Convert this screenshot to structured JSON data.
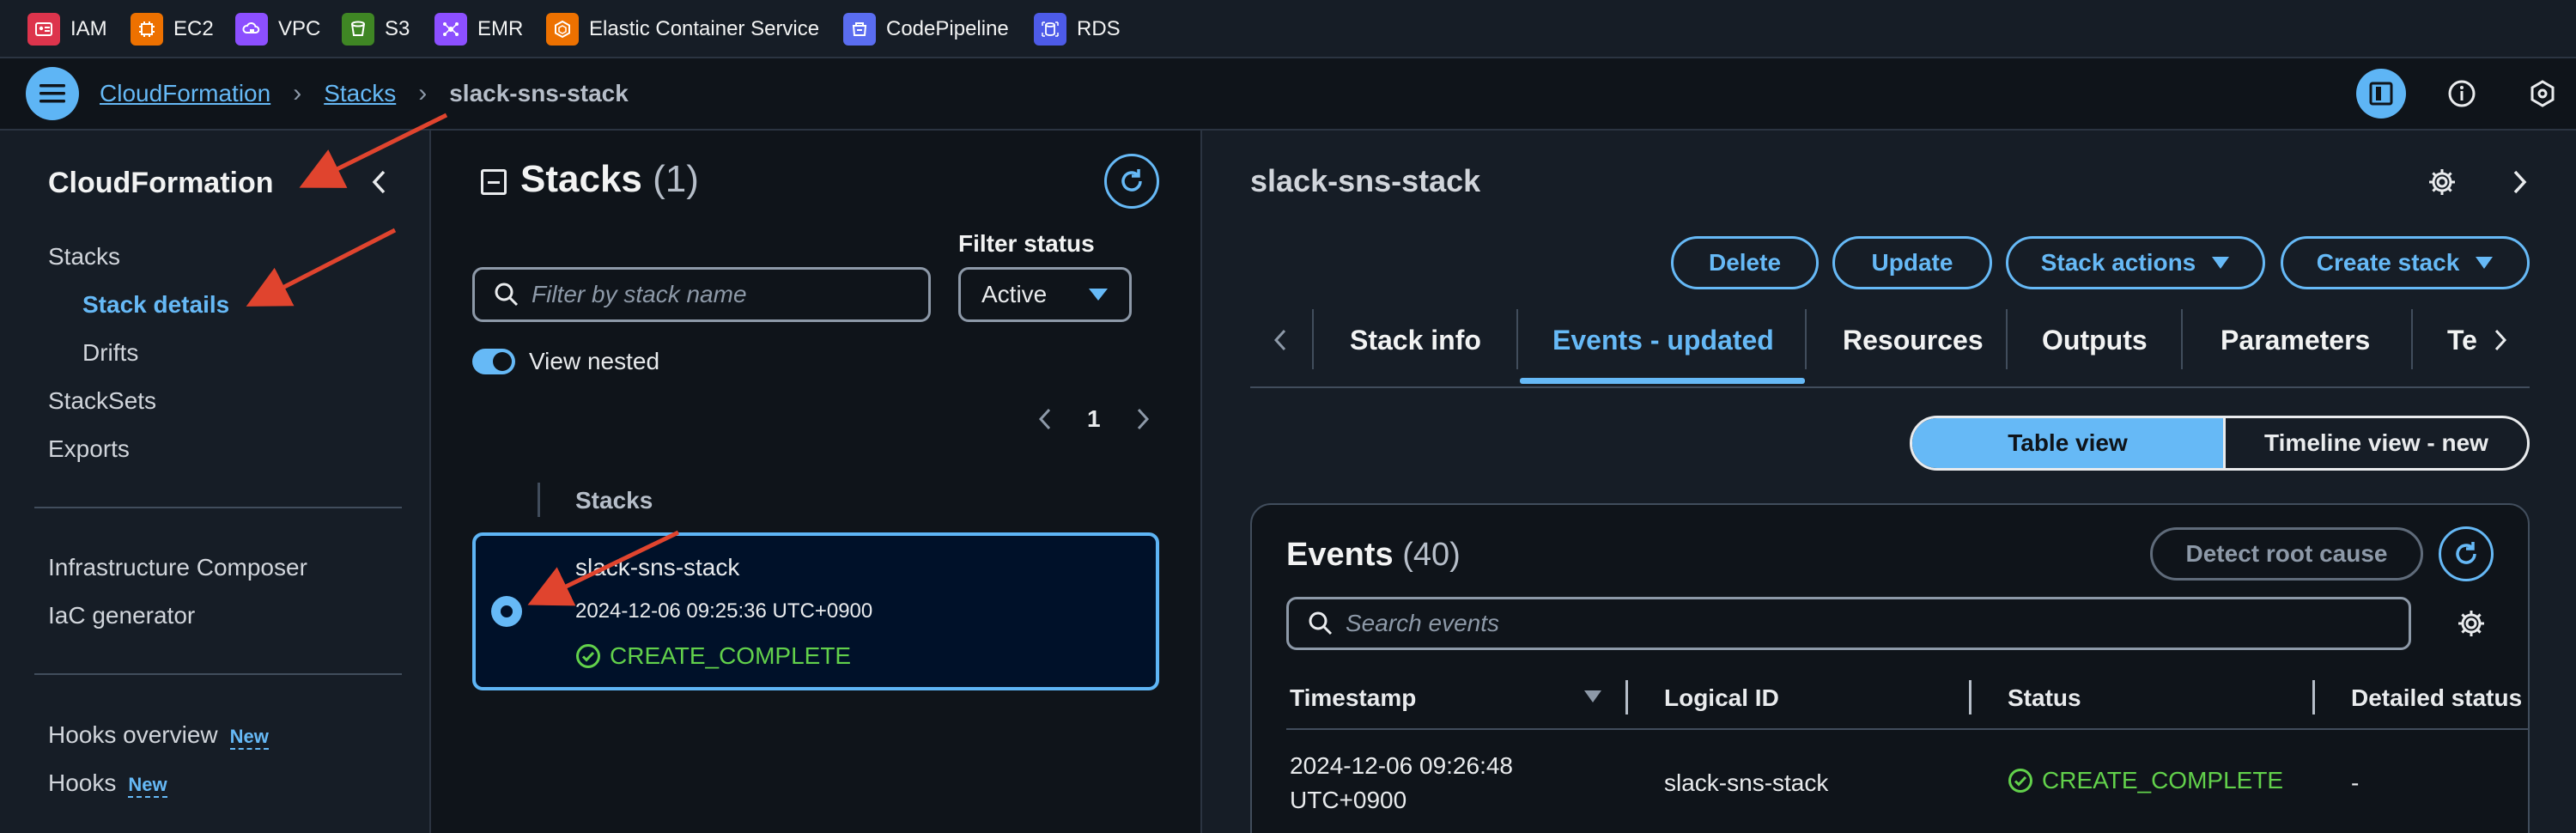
{
  "services": [
    {
      "label": "IAM",
      "icon": "iam-icon",
      "color": "#dd344c"
    },
    {
      "label": "EC2",
      "icon": "ec2-icon",
      "color": "#ed7100"
    },
    {
      "label": "VPC",
      "icon": "vpc-icon",
      "color": "#8c4fff"
    },
    {
      "label": "S3",
      "icon": "s3-icon",
      "color": "#3f8624"
    },
    {
      "label": "EMR",
      "icon": "emr-icon",
      "color": "#8c4fff"
    },
    {
      "label": "Elastic Container Service",
      "icon": "ecs-icon",
      "color": "#ed7100"
    },
    {
      "label": "CodePipeline",
      "icon": "codepipeline-icon",
      "color": "#5a6df0"
    },
    {
      "label": "RDS",
      "icon": "rds-icon",
      "color": "#4d5be8"
    }
  ],
  "breadcrumb": {
    "items": [
      "CloudFormation",
      "Stacks"
    ],
    "current": "slack-sns-stack"
  },
  "leftnav": {
    "title": "CloudFormation",
    "items": [
      {
        "label": "Stacks"
      },
      {
        "label": "Stack details"
      },
      {
        "label": "Drifts"
      },
      {
        "label": "StackSets"
      },
      {
        "label": "Exports"
      },
      {
        "label": "Infrastructure Composer"
      },
      {
        "label": "IaC generator"
      },
      {
        "label": "Hooks overview"
      },
      {
        "label": "Hooks"
      }
    ],
    "new_badge": "New"
  },
  "stacks": {
    "heading": "Stacks",
    "count": "(1)",
    "search_placeholder": "Filter by stack name",
    "filter_label": "Filter status",
    "filter_value": "Active",
    "view_nested": "View nested",
    "page": "1",
    "column_header": "Stacks",
    "items": [
      {
        "name": "slack-sns-stack",
        "timestamp": "2024-12-06 09:25:36 UTC+0900",
        "status": "CREATE_COMPLETE"
      }
    ]
  },
  "detail": {
    "title": "slack-sns-stack",
    "buttons": {
      "delete": "Delete",
      "update": "Update",
      "stack_actions": "Stack actions",
      "create_stack": "Create stack"
    },
    "tabs": [
      "Stack info",
      "Events - updated",
      "Resources",
      "Outputs",
      "Parameters",
      "Te"
    ],
    "active_tab": "Events - updated",
    "views": {
      "table": "Table view",
      "timeline": "Timeline view - new"
    },
    "events": {
      "heading": "Events",
      "count": "(40)",
      "detect_button": "Detect root cause",
      "search_placeholder": "Search events",
      "columns": [
        "Timestamp",
        "Logical ID",
        "Status",
        "Detailed status"
      ],
      "rows": [
        {
          "timestamp_line1": "2024-12-06 09:26:48",
          "timestamp_line2": "UTC+0900",
          "logical_id": "slack-sns-stack",
          "status": "CREATE_COMPLETE",
          "detailed_status": "-"
        }
      ]
    }
  },
  "colors": {
    "accent": "#66b9f6",
    "success": "#62d14b",
    "annotation": "#e0442e"
  }
}
